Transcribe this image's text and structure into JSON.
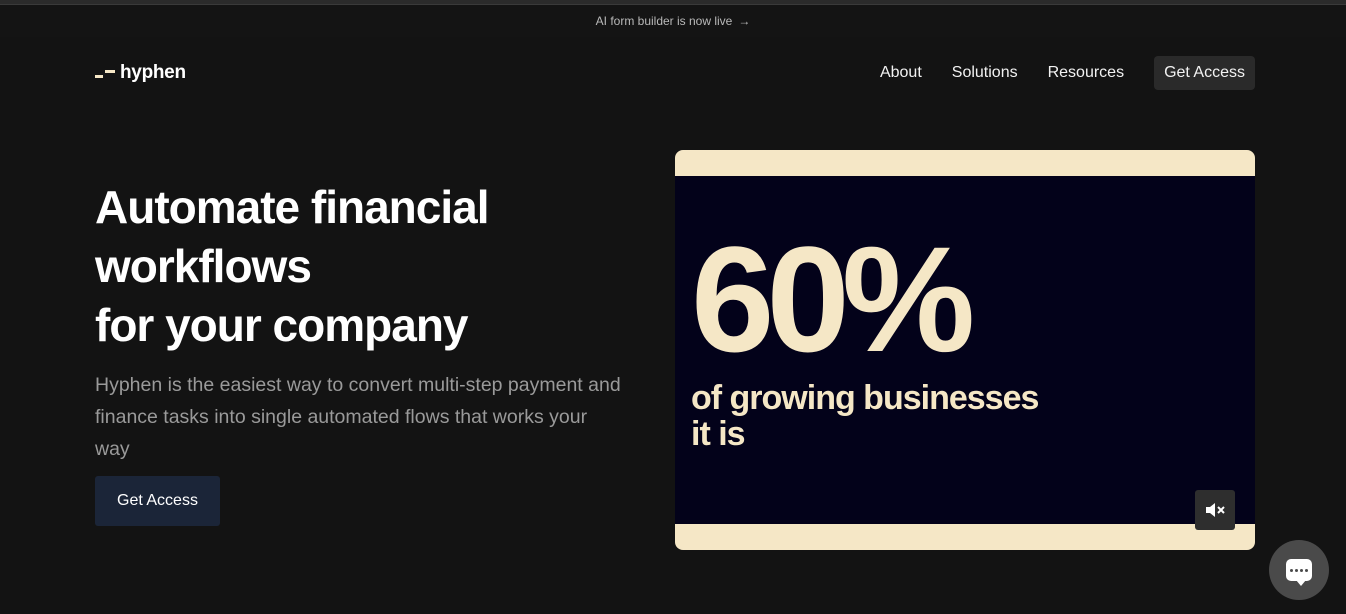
{
  "announcement": {
    "text": "AI form builder is now live",
    "arrow": "→"
  },
  "brand": {
    "name": "hyphen",
    "accent": "#f5e7c6"
  },
  "nav": {
    "items": [
      "About",
      "Solutions",
      "Resources"
    ],
    "cta": "Get Access"
  },
  "hero": {
    "title_lines": [
      "Automate financial",
      "workflows",
      "for your company"
    ],
    "subtitle": "Hyphen is the easiest way to convert multi-step payment and finance tasks into single automated flows that works your way",
    "cta": "Get Access",
    "cta_color": "#1b2538"
  },
  "video": {
    "stat": "60%",
    "line1": "of growing businesses",
    "line2": "it is",
    "background": "#03021a",
    "frame_color": "#f5e7c6",
    "mute_icon": "speaker-muted-icon"
  },
  "chat": {
    "icon": "chat-bubble-icon"
  }
}
